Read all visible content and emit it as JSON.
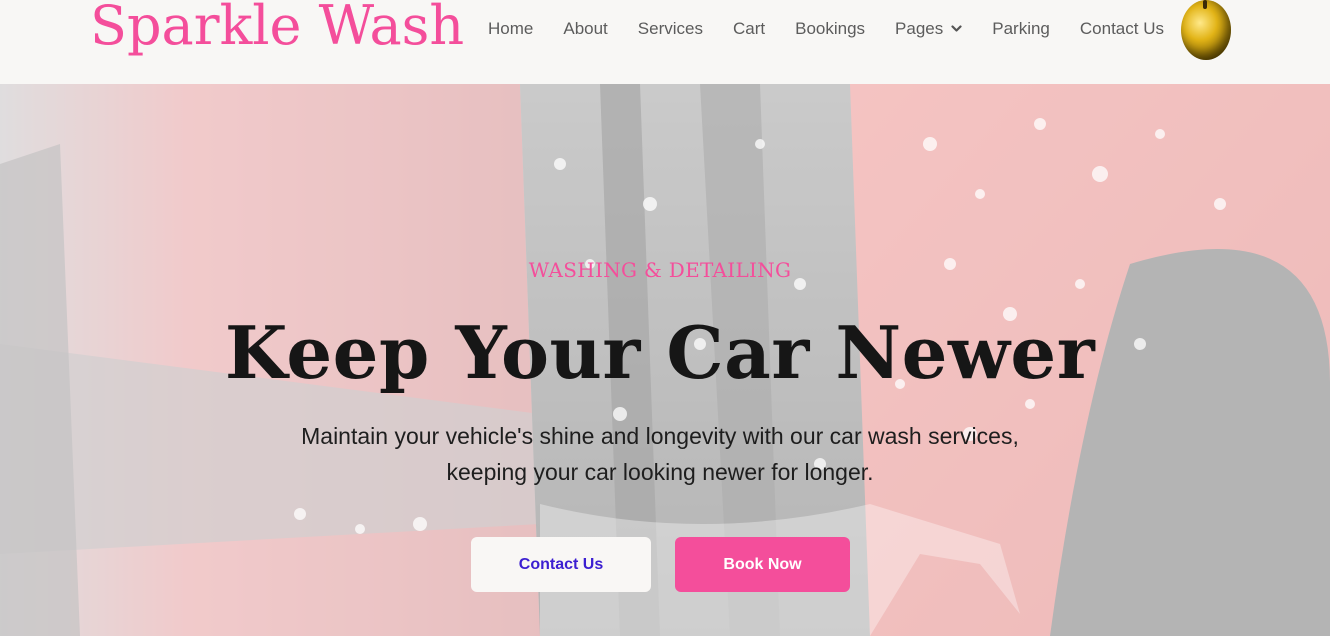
{
  "header": {
    "brand": "Sparkle Wash",
    "nav": [
      {
        "label": "Home"
      },
      {
        "label": "About"
      },
      {
        "label": "Services"
      },
      {
        "label": "Cart"
      },
      {
        "label": "Bookings"
      },
      {
        "label": "Pages",
        "has_dropdown": true
      },
      {
        "label": "Parking"
      },
      {
        "label": "Contact Us"
      }
    ],
    "avatar_icon": "golden-apple-avatar"
  },
  "hero": {
    "eyebrow": "WASHING & DETAILING",
    "title": "Keep Your Car Newer",
    "subtitle_line1": "Maintain your vehicle's shine and longevity with our car wash services,",
    "subtitle_line2": "keeping your car looking newer for longer.",
    "buttons": {
      "contact": "Contact Us",
      "book": "Book Now"
    }
  },
  "colors": {
    "brand_pink": "#f44e9b",
    "header_bg": "#f8f7f5",
    "contact_text": "#3c1fd1",
    "headline": "#161616"
  }
}
